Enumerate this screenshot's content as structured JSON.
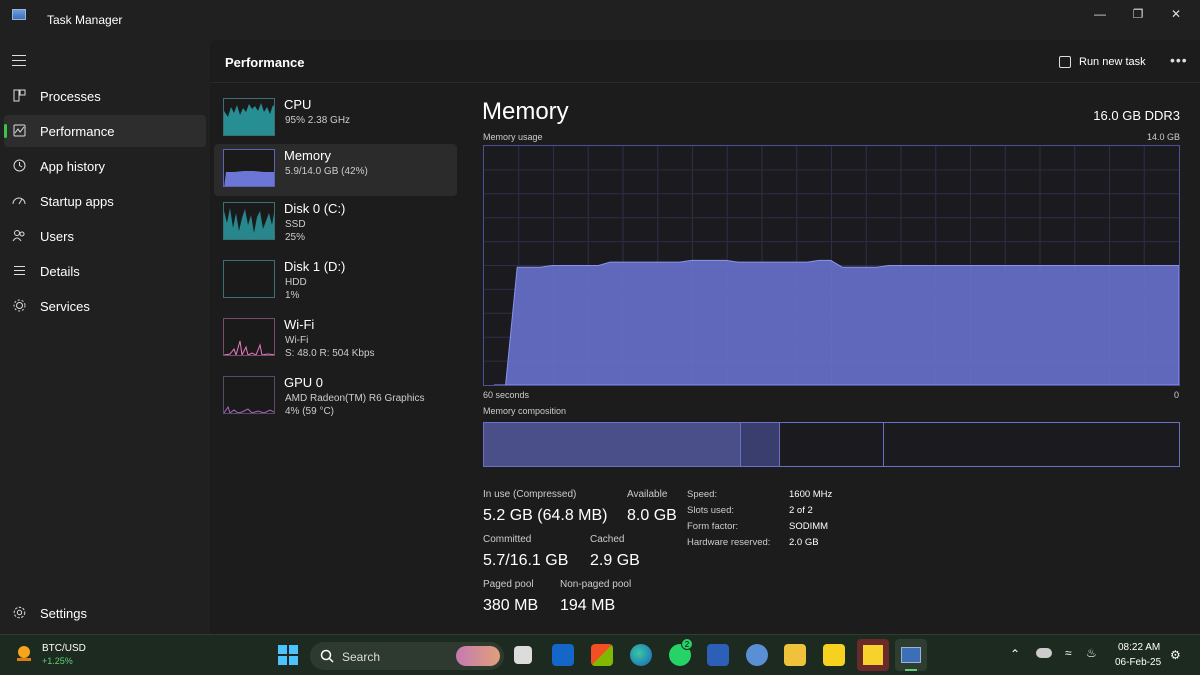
{
  "window": {
    "title": "Task Manager",
    "controls": [
      "minimize-icon",
      "restore-icon",
      "close-icon"
    ]
  },
  "nav": {
    "items": [
      {
        "label": "Processes",
        "icon": "processes-grid-icon",
        "active": false
      },
      {
        "label": "Performance",
        "icon": "performance-chart-icon",
        "active": true
      },
      {
        "label": "App history",
        "icon": "history-clock-icon",
        "active": false
      },
      {
        "label": "Startup apps",
        "icon": "speedometer-icon",
        "active": false
      },
      {
        "label": "Users",
        "icon": "users-icon",
        "active": false
      },
      {
        "label": "Details",
        "icon": "list-details-icon",
        "active": false
      },
      {
        "label": "Services",
        "icon": "services-puzzle-icon",
        "active": false
      }
    ],
    "settings_label": "Settings"
  },
  "header": {
    "title": "Performance",
    "run_new_task": "Run new task"
  },
  "devices": [
    {
      "name": "CPU",
      "line1": "95% 2.38 GHz",
      "line2": "",
      "color": "#2aa3a9"
    },
    {
      "name": "Memory",
      "line1": "5.9/14.0 GB (42%)",
      "line2": "",
      "color": "#6b76d6",
      "active": true
    },
    {
      "name": "Disk 0 (C:)",
      "line1": "SSD",
      "line2": "25%",
      "color": "#2aa3a9"
    },
    {
      "name": "Disk 1 (D:)",
      "line1": "HDD",
      "line2": "1%",
      "color": "#2aa3a9"
    },
    {
      "name": "Wi-Fi",
      "line1": "Wi-Fi",
      "line2": "S: 48.0  R: 504 Kbps",
      "color": "#e57bbd"
    },
    {
      "name": "GPU 0",
      "line1": "AMD Radeon(TM) R6 Graphics",
      "line2": "4% (59 °C)",
      "color": "#a16bbf"
    }
  ],
  "memory": {
    "title": "Memory",
    "spec": "16.0 GB DDR3",
    "usage_label": "Memory usage",
    "usage_max": "14.0 GB",
    "x_left": "60 seconds",
    "x_right": "0",
    "composition_label": "Memory composition",
    "usage_history_gb": [
      0,
      0,
      6.9,
      6.9,
      6.9,
      7.0,
      7.0,
      7.0,
      7.0,
      7.0,
      7.2,
      7.2,
      7.2,
      7.2,
      7.2,
      7.2,
      7.2,
      7.3,
      7.3,
      7.3,
      7.3,
      7.2,
      7.2,
      7.2,
      7.2,
      7.2,
      7.2,
      7.2,
      7.3,
      7.3,
      6.9,
      6.9,
      6.9,
      6.9,
      7.0,
      7.0,
      7.0,
      7.0,
      7.0,
      7.0,
      7.0,
      7.0,
      7.0,
      7.0,
      7.0,
      7.0,
      7.0,
      7.0,
      7.0,
      7.0,
      7.0,
      7.0,
      7.0,
      7.0,
      7.0,
      7.0,
      7.0,
      7.0,
      7.0,
      7.0
    ],
    "composition_split": {
      "in_use": 0.37,
      "modified": 0.056,
      "standby": 0.15,
      "free": 0.424
    },
    "stats": {
      "in_use_label": "In use (Compressed)",
      "in_use_value": "5.2 GB (64.8 MB)",
      "available_label": "Available",
      "available_value": "8.0 GB",
      "committed_label": "Committed",
      "committed_value": "5.7/16.1 GB",
      "cached_label": "Cached",
      "cached_value": "2.9 GB",
      "paged_label": "Paged pool",
      "paged_value": "380 MB",
      "nonpaged_label": "Non-paged pool",
      "nonpaged_value": "194 MB"
    },
    "details": [
      {
        "k": "Speed:",
        "v": "1600 MHz"
      },
      {
        "k": "Slots used:",
        "v": "2 of 2"
      },
      {
        "k": "Form factor:",
        "v": "SODIMM"
      },
      {
        "k": "Hardware reserved:",
        "v": "2.0 GB"
      }
    ]
  },
  "taskbar": {
    "ticker": "BTC/USD",
    "ticker_change": "+1.25%",
    "search_label": "Search",
    "whatsapp_badge": "2",
    "time": "08:22 AM",
    "date": "06-Feb-25",
    "colors": {
      "accent": "#4cc2ff",
      "graph_fill": "#6b76d6"
    }
  }
}
